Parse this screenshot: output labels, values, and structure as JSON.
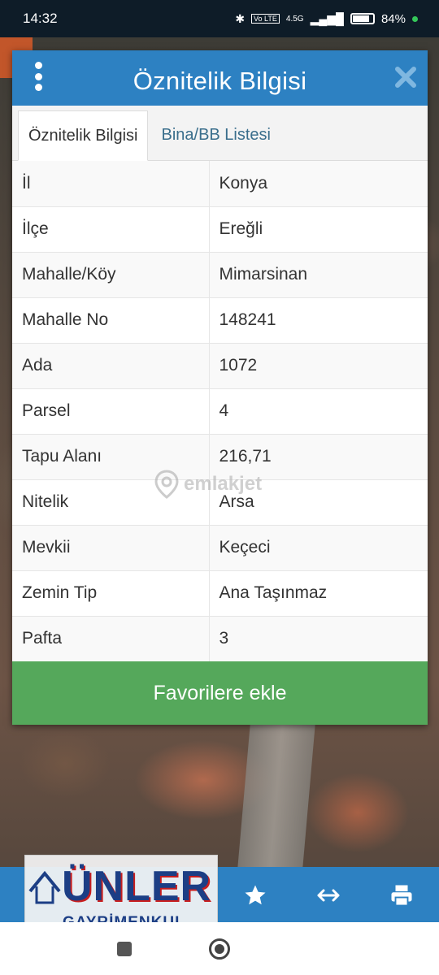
{
  "status_bar": {
    "time": "14:32",
    "network": "4.5G",
    "volte": "Vo LTE",
    "battery": "84%"
  },
  "dialog": {
    "title": "Öznitelik Bilgisi",
    "tabs": [
      {
        "label": "Öznitelik Bilgisi",
        "active": true
      },
      {
        "label": "Bina/BB Listesi",
        "active": false
      }
    ],
    "rows": [
      {
        "key": "İl",
        "value": "Konya"
      },
      {
        "key": "İlçe",
        "value": "Ereğli"
      },
      {
        "key": "Mahalle/Köy",
        "value": "Mimarsinan"
      },
      {
        "key": "Mahalle No",
        "value": "148241"
      },
      {
        "key": "Ada",
        "value": "1072"
      },
      {
        "key": "Parsel",
        "value": "4"
      },
      {
        "key": "Tapu Alanı",
        "value": "216,71"
      },
      {
        "key": "Nitelik",
        "value": "Arsa"
      },
      {
        "key": "Mevkii",
        "value": "Keçeci"
      },
      {
        "key": "Zemin Tip",
        "value": "Ana Taşınmaz"
      },
      {
        "key": "Pafta",
        "value": "3"
      }
    ],
    "favorite_button": "Favorilere ekle"
  },
  "watermark": "emlakjet",
  "logo": {
    "title": "ÜNLER",
    "subtitle": "GAYRİMENKUL"
  },
  "toolbar": {
    "icons": [
      "star-icon",
      "arrows-horizontal-icon",
      "print-icon"
    ]
  },
  "colors": {
    "header_blue": "#2d81c2",
    "button_green": "#55a85b",
    "tab_text": "#3a6e8c"
  }
}
